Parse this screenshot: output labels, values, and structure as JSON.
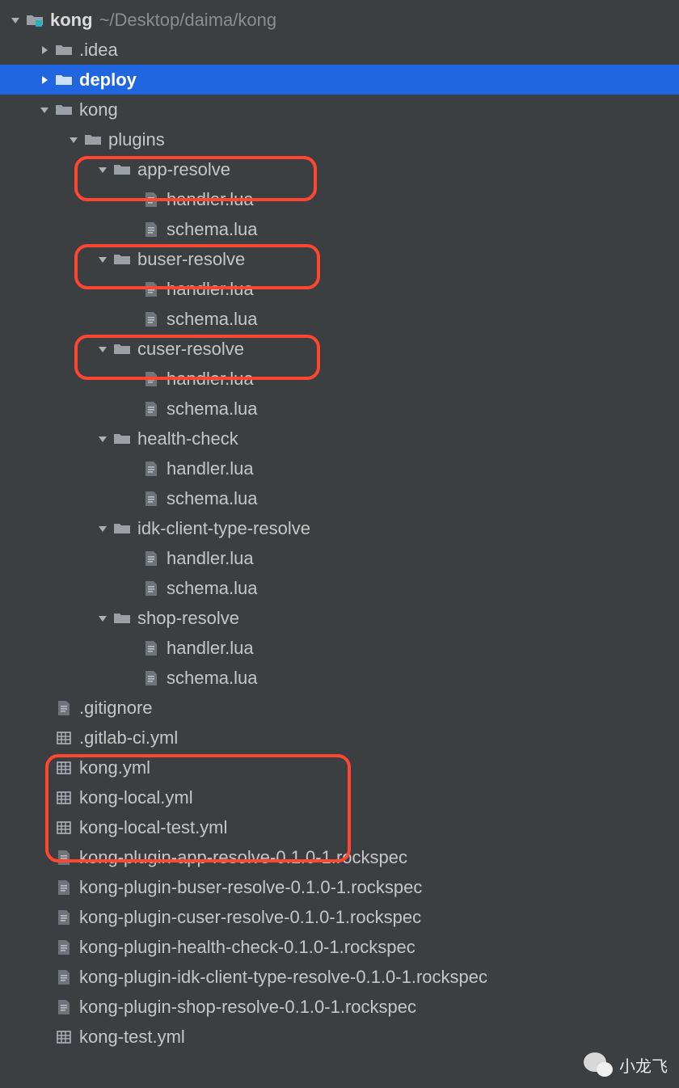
{
  "root": {
    "name": "kong",
    "path": "~/Desktop/daima/kong"
  },
  "idea": ".idea",
  "deploy": "deploy",
  "kong_dir": "kong",
  "plugins_dir": "plugins",
  "plugins": {
    "app_resolve": "app-resolve",
    "buser_resolve": "buser-resolve",
    "cuser_resolve": "cuser-resolve",
    "health_check": "health-check",
    "idk_client": "idk-client-type-resolve",
    "shop_resolve": "shop-resolve",
    "handler": "handler.lua",
    "schema": "schema.lua"
  },
  "files": {
    "gitignore": ".gitignore",
    "gitlab_ci": ".gitlab-ci.yml",
    "kong_yml": "kong.yml",
    "kong_local": "kong-local.yml",
    "kong_local_test": "kong-local-test.yml",
    "rs_app": "kong-plugin-app-resolve-0.1.0-1.rockspec",
    "rs_buser": "kong-plugin-buser-resolve-0.1.0-1.rockspec",
    "rs_cuser": "kong-plugin-cuser-resolve-0.1.0-1.rockspec",
    "rs_health": "kong-plugin-health-check-0.1.0-1.rockspec",
    "rs_idk": "kong-plugin-idk-client-type-resolve-0.1.0-1.rockspec",
    "rs_shop": "kong-plugin-shop-resolve-0.1.0-1.rockspec",
    "kong_test": "kong-test.yml"
  },
  "watermark": "小龙飞"
}
